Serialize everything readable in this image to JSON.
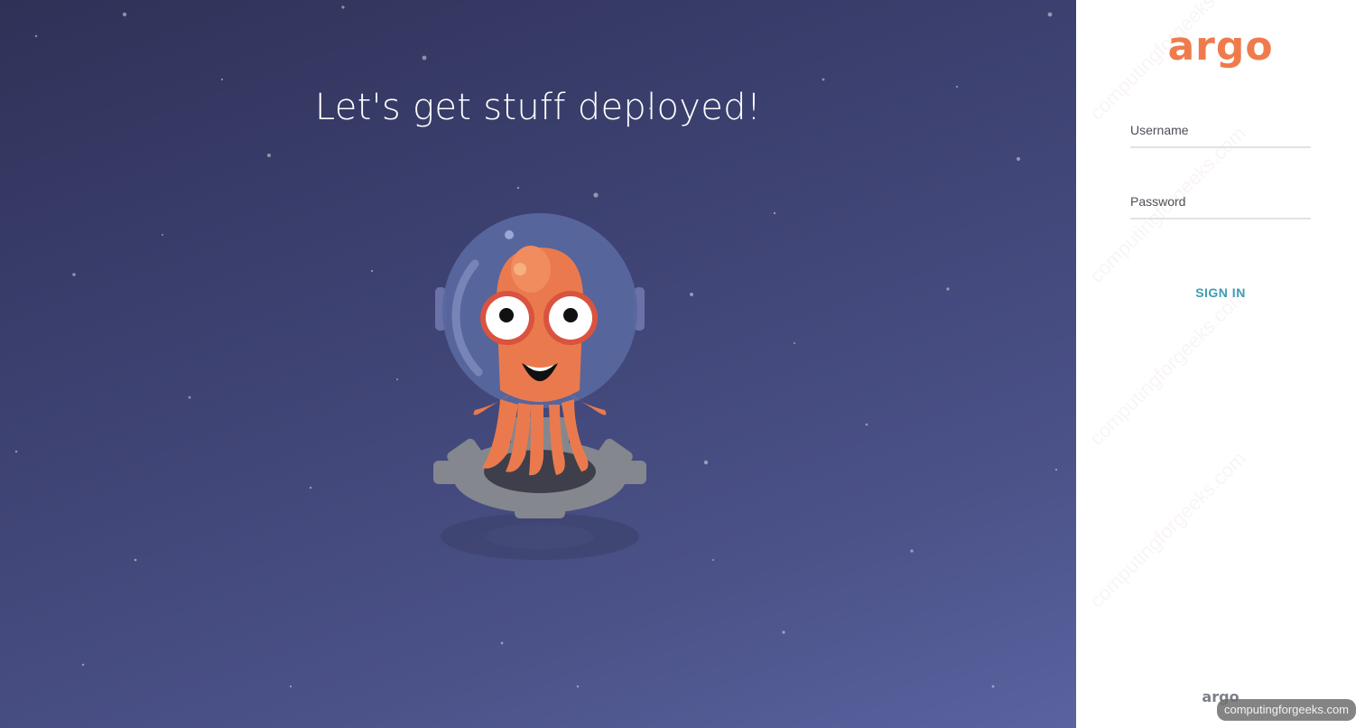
{
  "hero": {
    "headline": "Let's get stuff deployed!"
  },
  "login": {
    "logo_text": "argo",
    "username_label": "Username",
    "password_label": "Password",
    "signin_label": "SIGN IN",
    "footer_logo": "argo"
  },
  "watermark": {
    "text": "computingforgeeks.com"
  },
  "colors": {
    "brand_orange": "#ef7b4d",
    "signin_teal": "#3c9cb4",
    "hero_background": "#3d4272"
  },
  "icons": {
    "mascot": "argo-octopus-astronaut-icon"
  }
}
